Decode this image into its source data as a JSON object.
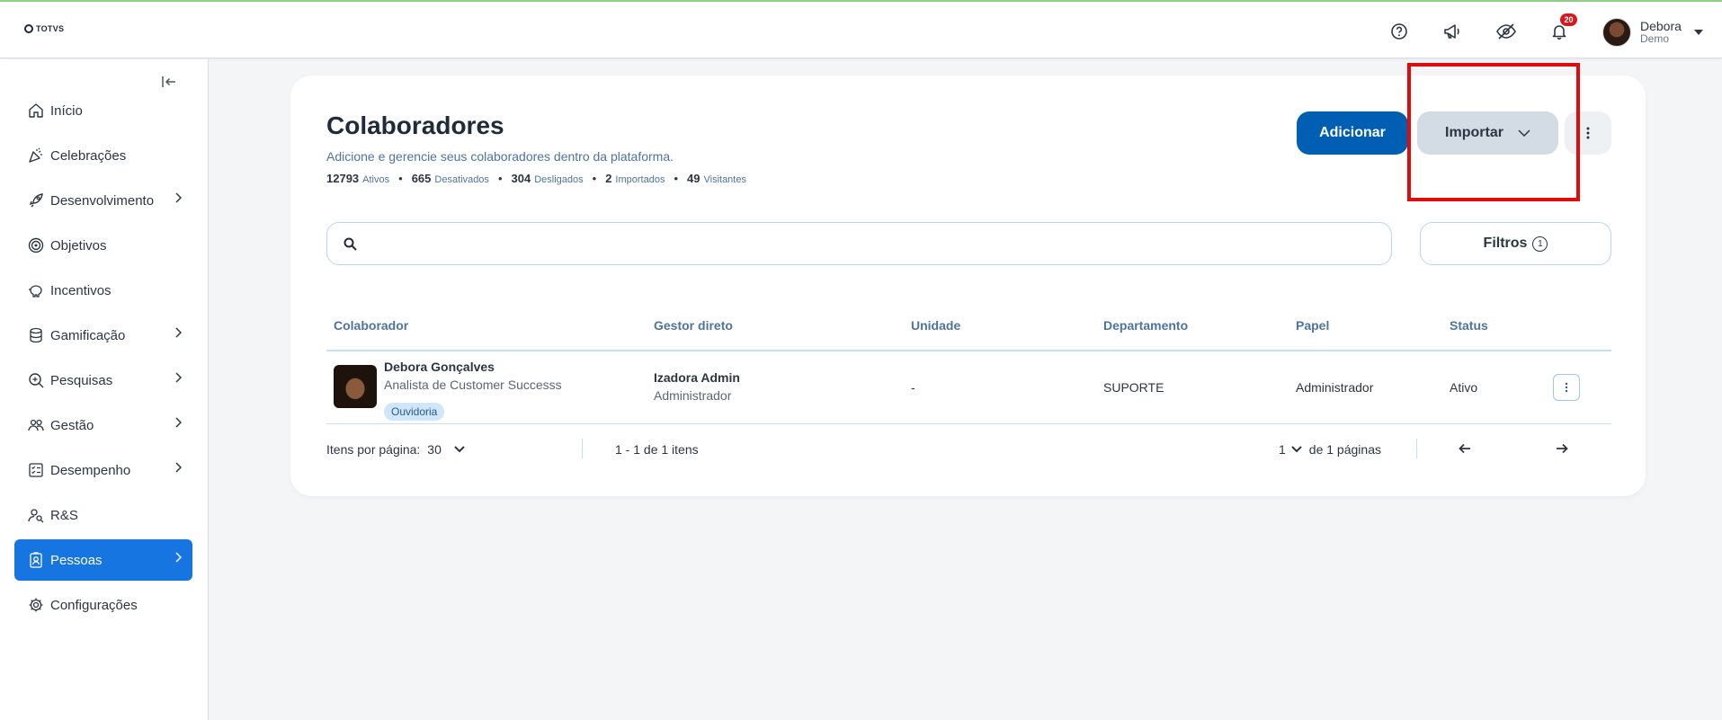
{
  "app": {
    "logo_text": "TOTVS"
  },
  "topbar": {
    "help_icon": "help-circle-icon",
    "announce_icon": "megaphone-icon",
    "hide_icon": "eye-off-icon",
    "notifications_icon": "bell-icon",
    "notifications_count": "20",
    "user": {
      "name": "Debora",
      "role": "Demo"
    }
  },
  "sidebar": {
    "items": [
      {
        "label": "Início",
        "icon": "home-icon",
        "has_submenu": false
      },
      {
        "label": "Celebrações",
        "icon": "party-icon",
        "has_submenu": false
      },
      {
        "label": "Desenvolvimento",
        "icon": "rocket-icon",
        "has_submenu": true
      },
      {
        "label": "Objetivos",
        "icon": "target-icon",
        "has_submenu": false
      },
      {
        "label": "Incentivos",
        "icon": "piggy-bank-icon",
        "has_submenu": false
      },
      {
        "label": "Gamificação",
        "icon": "coins-icon",
        "has_submenu": true
      },
      {
        "label": "Pesquisas",
        "icon": "search-doc-icon",
        "has_submenu": true
      },
      {
        "label": "Gestão",
        "icon": "people-icon",
        "has_submenu": true
      },
      {
        "label": "Desempenho",
        "icon": "checklist-icon",
        "has_submenu": true
      },
      {
        "label": "R&S",
        "icon": "user-search-icon",
        "has_submenu": false
      },
      {
        "label": "Pessoas",
        "icon": "badge-icon",
        "has_submenu": true,
        "active": true
      },
      {
        "label": "Configurações",
        "icon": "gear-icon",
        "has_submenu": false
      }
    ]
  },
  "page": {
    "title": "Colaboradores",
    "subtitle": "Adicione e gerencie seus colaboradores dentro da plataforma.",
    "stats": [
      {
        "value": "12793",
        "label": "Ativos"
      },
      {
        "value": "665",
        "label": "Desativados"
      },
      {
        "value": "304",
        "label": "Desligados"
      },
      {
        "value": "2",
        "label": "Importados"
      },
      {
        "value": "49",
        "label": "Visitantes"
      }
    ],
    "add_label": "Adicionar",
    "import_label": "Importar",
    "filters_label": "Filtros",
    "filters_count": "1",
    "search_value": ""
  },
  "table": {
    "headers": [
      "Colaborador",
      "Gestor direto",
      "Unidade",
      "Departamento",
      "Papel",
      "Status"
    ],
    "rows": [
      {
        "name": "Debora Gonçalves",
        "title": "Analista de Customer Successs",
        "tag": "Ouvidoria",
        "manager_name": "Izadora Admin",
        "manager_role": "Administrador",
        "unit": "-",
        "department": "SUPORTE",
        "role": "Administrador",
        "status": "Ativo"
      }
    ]
  },
  "pagination": {
    "per_page_label": "Itens por página:",
    "per_page_value": "30",
    "range": "1 - 1 de 1 itens",
    "current_page": "1",
    "of_pages": "de 1 páginas"
  },
  "colors": {
    "accent": "#1675e0",
    "primary_button": "#005fb3",
    "highlight": "#e10b0b"
  }
}
